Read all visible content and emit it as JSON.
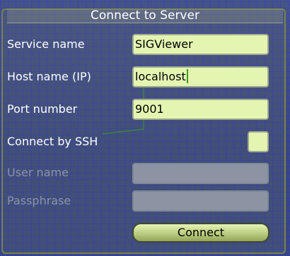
{
  "dialog": {
    "title": "Connect to Server"
  },
  "form": {
    "service_name": {
      "label": "Service name",
      "value": "SIGViewer"
    },
    "host_name": {
      "label": "Host name (IP)",
      "value": "localhost"
    },
    "port_number": {
      "label": "Port number",
      "value": "9001"
    },
    "connect_by_ssh": {
      "label": "Connect by SSH",
      "checked": false
    },
    "user_name": {
      "label": "User name",
      "value": ""
    },
    "passphrase": {
      "label": "Passphrase",
      "value": ""
    }
  },
  "connect_button": {
    "label": "Connect"
  },
  "colors": {
    "field_background": "#e4f5b2",
    "disabled_field": "#8c94a3",
    "text": "#ffffff",
    "disabled_text": "#8c93a8",
    "caret": "#3d9a22"
  }
}
